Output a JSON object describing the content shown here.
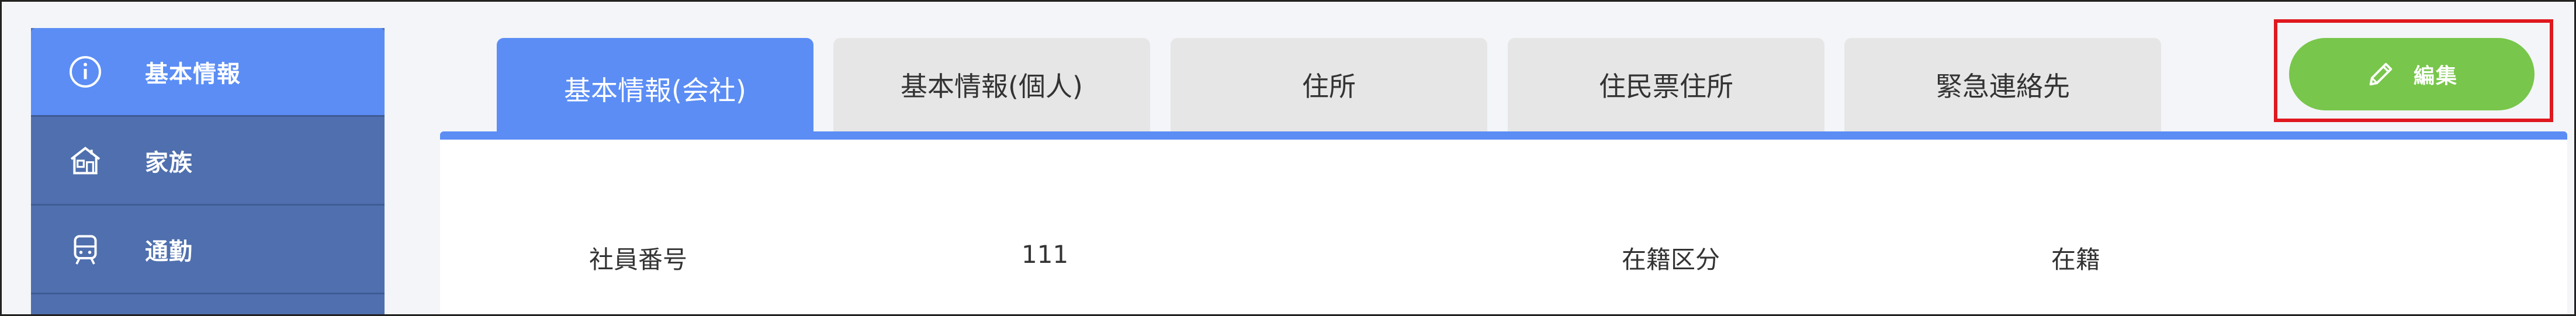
{
  "sidebar": {
    "items": [
      {
        "label": "基本情報",
        "icon": "info-icon"
      },
      {
        "label": "家族",
        "icon": "house-icon"
      },
      {
        "label": "通勤",
        "icon": "train-icon"
      }
    ]
  },
  "tabs": [
    {
      "label": "基本情報(会社)",
      "active": true
    },
    {
      "label": "基本情報(個人)",
      "active": false
    },
    {
      "label": "住所",
      "active": false
    },
    {
      "label": "住民票住所",
      "active": false
    },
    {
      "label": "緊急連絡先",
      "active": false
    }
  ],
  "toolbar": {
    "edit_label": "編集",
    "edit_icon": "pencil-icon"
  },
  "fields": [
    {
      "label": "社員番号",
      "value": "111"
    },
    {
      "label": "在籍区分",
      "value": "在籍"
    }
  ],
  "colors": {
    "sidebar_bg": "#4f6fae",
    "sidebar_active": "#5b8df5",
    "tab_active": "#5b8df5",
    "tab_inactive": "#e6e6e6",
    "edit_button": "#78c64b",
    "highlight_outline": "#e0181f"
  }
}
